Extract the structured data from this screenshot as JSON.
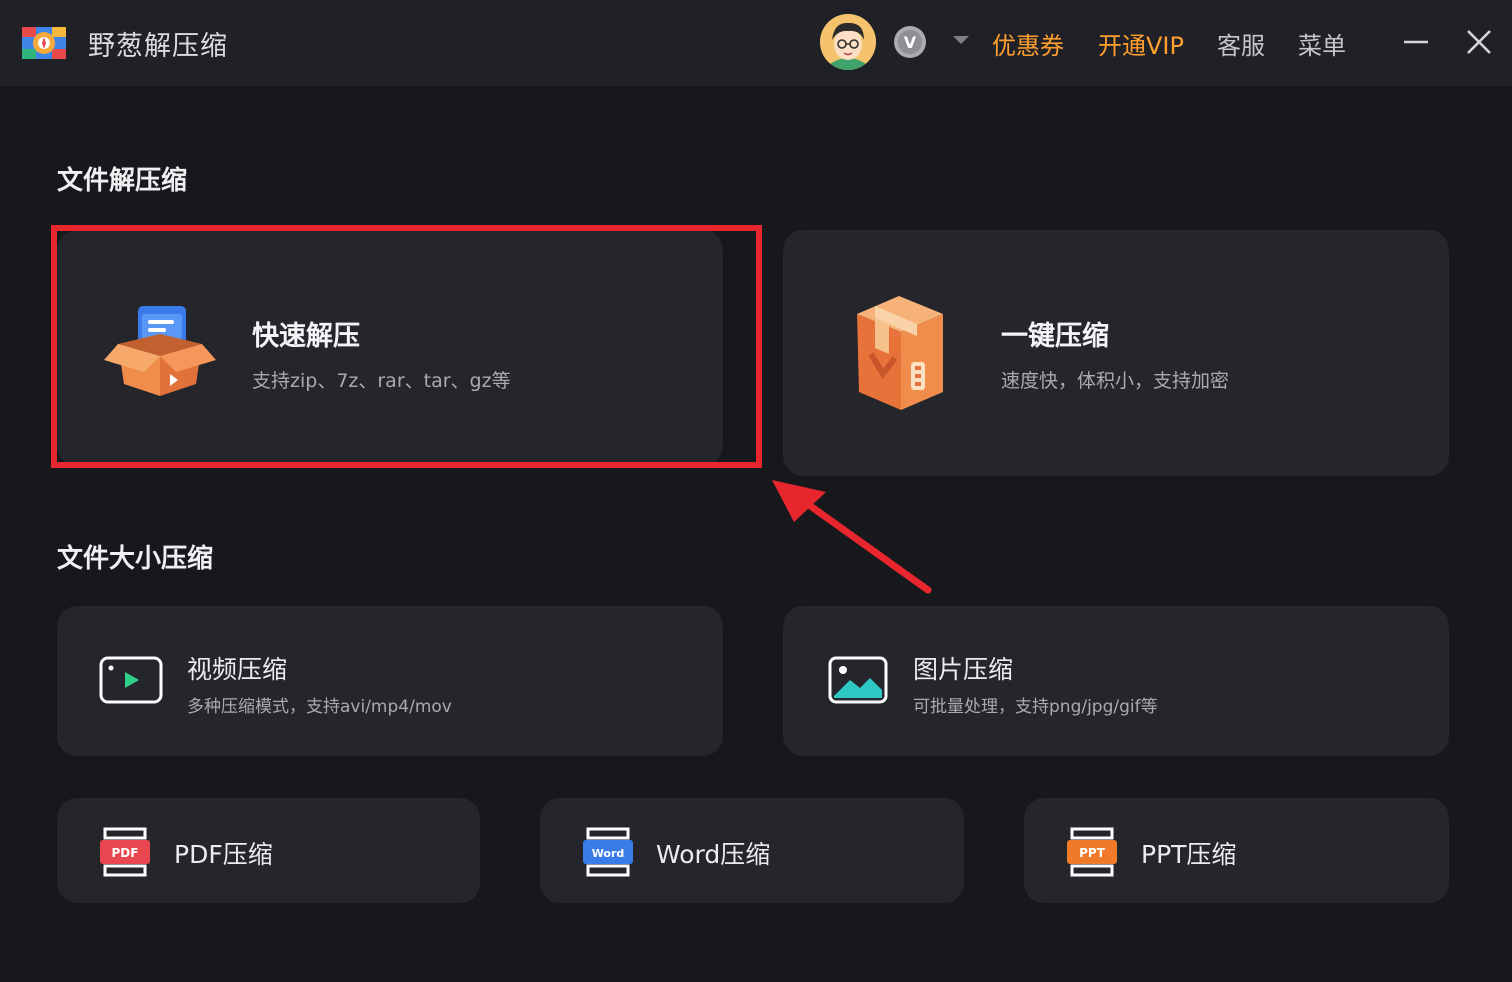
{
  "app": {
    "title": "野葱解压缩"
  },
  "header": {
    "coupon_label": "优惠券",
    "vip_label": "开通VIP",
    "service_label": "客服",
    "menu_label": "菜单",
    "vip_badge_letter": "V"
  },
  "section_decompress": {
    "title": "文件解压缩",
    "cards": [
      {
        "title": "快速解压",
        "desc": "支持zip、7z、rar、tar、gz等",
        "icon": "open-box-icon"
      },
      {
        "title": "一键压缩",
        "desc": "速度快，体积小，支持加密",
        "icon": "zip-box-icon"
      }
    ]
  },
  "section_size": {
    "title": "文件大小压缩",
    "cards": [
      {
        "title": "视频压缩",
        "desc": "多种压缩模式，支持avi/mp4/mov",
        "icon": "video-icon"
      },
      {
        "title": "图片压缩",
        "desc": "可批量处理，支持png/jpg/gif等",
        "icon": "image-icon"
      }
    ],
    "doc_cards": [
      {
        "title": "PDF压缩",
        "badge": "PDF",
        "badge_color": "#e8474f",
        "icon": "pdf-icon"
      },
      {
        "title": "Word压缩",
        "badge": "Word",
        "badge_color": "#3a7bea",
        "icon": "word-icon"
      },
      {
        "title": "PPT压缩",
        "badge": "PPT",
        "badge_color": "#f07a2a",
        "icon": "ppt-icon"
      }
    ]
  },
  "colors": {
    "accent_orange": "#ff9f2f",
    "highlight_red": "#e8262d",
    "card_bg": "#24262b",
    "page_bg": "#17181c"
  }
}
